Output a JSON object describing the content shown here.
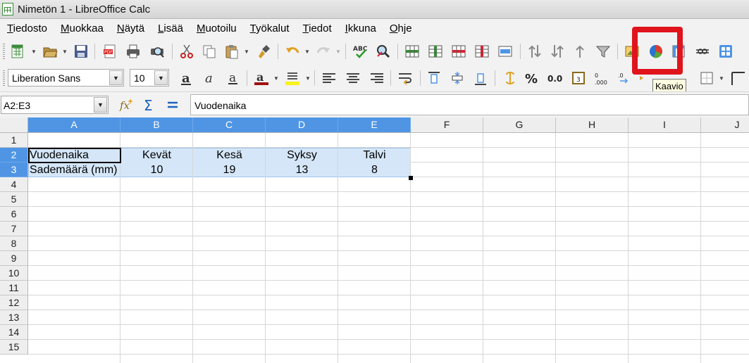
{
  "window": {
    "title": "Nimetön 1 - LibreOffice Calc"
  },
  "menu": [
    "Tiedosto",
    "Muokkaa",
    "Näytä",
    "Lisää",
    "Muotoilu",
    "Työkalut",
    "Tiedot",
    "Ikkuna",
    "Ohje"
  ],
  "format_toolbar": {
    "font_name": "Liberation Sans",
    "font_size": "10"
  },
  "tooltip": "Kaavio",
  "formula_bar": {
    "name_box": "A2:E3",
    "formula": "Vuodenaika"
  },
  "sheet": {
    "columns": [
      "A",
      "B",
      "C",
      "D",
      "E",
      "F",
      "G",
      "H",
      "I",
      "J"
    ],
    "rows": [
      "1",
      "2",
      "3",
      "4",
      "5",
      "6",
      "7",
      "8",
      "9",
      "10",
      "11",
      "12",
      "13",
      "14",
      "15"
    ],
    "cells": {
      "A2": "Vuodenaika",
      "B2": "Kevät",
      "C2": "Kesä",
      "D2": "Syksy",
      "E2": "Talvi",
      "A3": "Sademäärä (mm)",
      "B3": "10",
      "C3": "19",
      "D3": "13",
      "E3": "8"
    },
    "selection": "A2:E3",
    "selection_color": "#d4e6f8",
    "header_selected_color": "#4f95e4"
  },
  "highlight_color": "#e0141c",
  "icons": {
    "toolbar1": [
      "new-icon",
      "open-icon",
      "save-icon",
      "export-pdf-icon",
      "print-icon",
      "print-preview-icon",
      "cut-icon",
      "copy-icon",
      "paste-icon",
      "clone-formatting-icon",
      "undo-icon",
      "redo-icon",
      "spellcheck-icon",
      "find-replace-icon",
      "row-icon",
      "column-icon",
      "delete-row-icon",
      "delete-column-icon",
      "merge-cells-icon",
      "sort-ascending-icon",
      "sort-descending-icon",
      "sort-icon",
      "autofilter-icon",
      "image-icon",
      "chart-icon",
      "pivot-table-icon",
      "special-character-icon",
      "navigator-icon"
    ]
  }
}
